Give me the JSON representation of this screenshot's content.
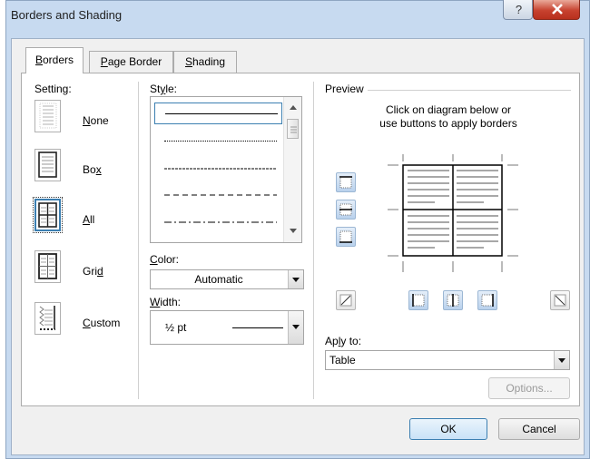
{
  "window": {
    "title": "Borders and Shading",
    "help_icon": "question-icon",
    "close_icon": "close-icon"
  },
  "tabs": [
    {
      "label": "Borders",
      "accel": "B",
      "rest": "orders",
      "active": true
    },
    {
      "label": "Page Border",
      "accel": "P",
      "rest": "age Border",
      "active": false
    },
    {
      "label": "Shading",
      "accel": "S",
      "rest": "hading",
      "active": false
    }
  ],
  "setting": {
    "label": "Setting:",
    "items": [
      {
        "name": "none",
        "pre": "",
        "accel": "N",
        "post": "one",
        "icon": "border-none-icon"
      },
      {
        "name": "box",
        "pre": "Bo",
        "accel": "x",
        "post": "",
        "icon": "border-box-icon"
      },
      {
        "name": "all",
        "pre": "",
        "accel": "A",
        "post": "ll",
        "icon": "border-all-icon",
        "selected": true
      },
      {
        "name": "grid",
        "pre": "Gri",
        "accel": "d",
        "post": "",
        "icon": "border-grid-icon"
      },
      {
        "name": "custom",
        "pre": "",
        "accel": "C",
        "post": "ustom",
        "icon": "border-custom-icon"
      }
    ]
  },
  "style": {
    "label_pre": "St",
    "label_accel": "y",
    "label_post": "le:",
    "line_styles": [
      "solid",
      "dotted-fine",
      "dashed-small",
      "dashed",
      "dash-dot"
    ],
    "selected": "solid"
  },
  "color": {
    "label_pre": "",
    "label_accel": "C",
    "label_post": "olor:",
    "value": "Automatic"
  },
  "width": {
    "label_pre": "",
    "label_accel": "W",
    "label_post": "idth:",
    "value": "½ pt"
  },
  "preview": {
    "label": "Preview",
    "instruction_line1": "Click on diagram below or",
    "instruction_line2": "use buttons to apply borders"
  },
  "apply_to": {
    "label_pre": "Apply to:",
    "label_accel": "l",
    "value": "Table"
  },
  "buttons": {
    "options": "Options...",
    "ok": "OK",
    "cancel": "Cancel"
  },
  "colors": {
    "accent": "#3c7fb1",
    "frame": "#c7daf0",
    "close": "#c7422f"
  }
}
